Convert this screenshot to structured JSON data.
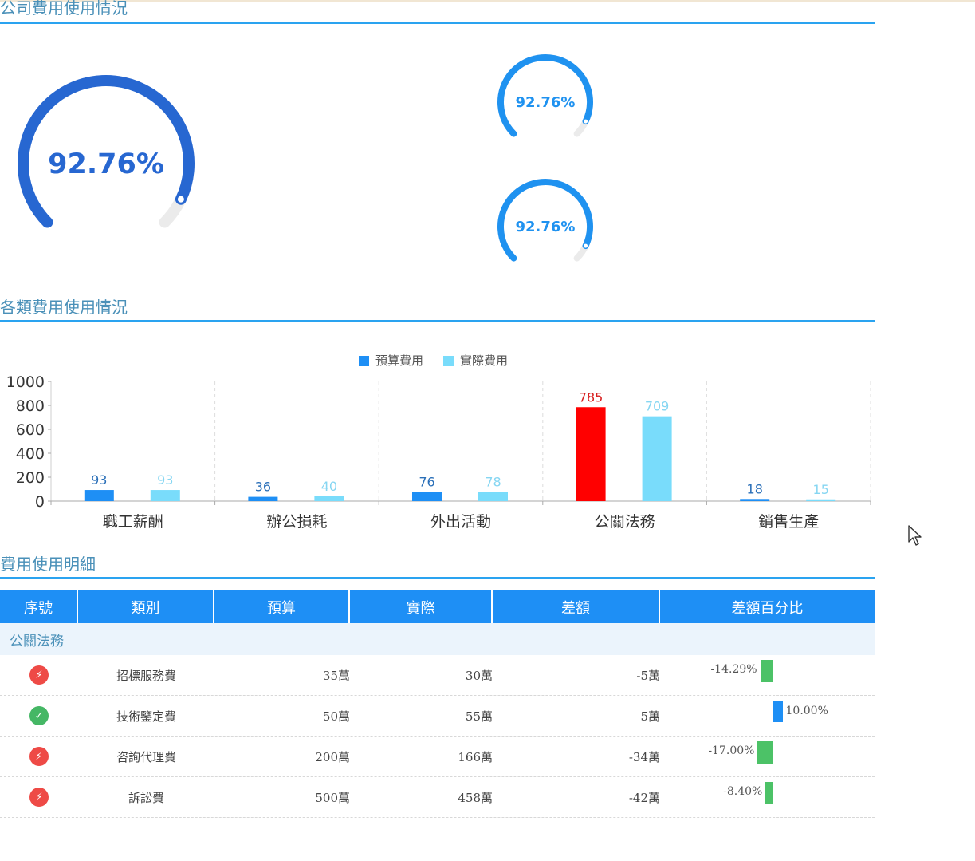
{
  "sections": {
    "overview_title": "公司費用使用情況",
    "category_title": "各類費用使用情況",
    "detail_title": "費用使用明細"
  },
  "gauges": {
    "main": {
      "value": 92.76,
      "label": "92.76%"
    },
    "upper": {
      "value": 92.76,
      "label": "92.76%"
    },
    "lower": {
      "value": 92.76,
      "label": "92.76%"
    }
  },
  "colors": {
    "gauge_main": "#2767d1",
    "gauge_small": "#1f92f0",
    "budget": "#1e8ff5",
    "actual": "#79dcfb",
    "highlight": "#ff0000",
    "header": "#1e8ff5",
    "negative_bar": "#4cc267",
    "positive_bar": "#1e8ff5"
  },
  "chart_data": {
    "type": "bar",
    "categories": [
      "職工薪酬",
      "辦公損耗",
      "外出活動",
      "公關法務",
      "銷售生產"
    ],
    "series": [
      {
        "name": "預算費用",
        "values": [
          93,
          36,
          76,
          785,
          18
        ]
      },
      {
        "name": "實際費用",
        "values": [
          93,
          40,
          78,
          709,
          15
        ]
      }
    ],
    "highlight_category": "公關法務",
    "yticks": [
      "0",
      "200",
      "400",
      "600",
      "800",
      "1000"
    ],
    "ylim": [
      0,
      1000
    ],
    "legend_position": "top-center",
    "grid": "vertical-dashed"
  },
  "table": {
    "headers": [
      "序號",
      "類別",
      "預算",
      "實際",
      "差額",
      "差額百分比"
    ],
    "group": "公關法務",
    "rows": [
      {
        "status": "bad",
        "category": "招標服務費",
        "budget": "35萬",
        "actual": "30萬",
        "diff": "-5萬",
        "pct_label": "-14.29%",
        "pct": -14.29
      },
      {
        "status": "good",
        "category": "技術鑒定費",
        "budget": "50萬",
        "actual": "55萬",
        "diff": "5萬",
        "pct_label": "10.00%",
        "pct": 10.0
      },
      {
        "status": "bad",
        "category": "咨詢代理費",
        "budget": "200萬",
        "actual": "166萬",
        "diff": "-34萬",
        "pct_label": "-17.00%",
        "pct": -17.0
      },
      {
        "status": "bad",
        "category": "訴訟費",
        "budget": "500萬",
        "actual": "458萬",
        "diff": "-42萬",
        "pct_label": "-8.40%",
        "pct": -8.4
      }
    ]
  }
}
